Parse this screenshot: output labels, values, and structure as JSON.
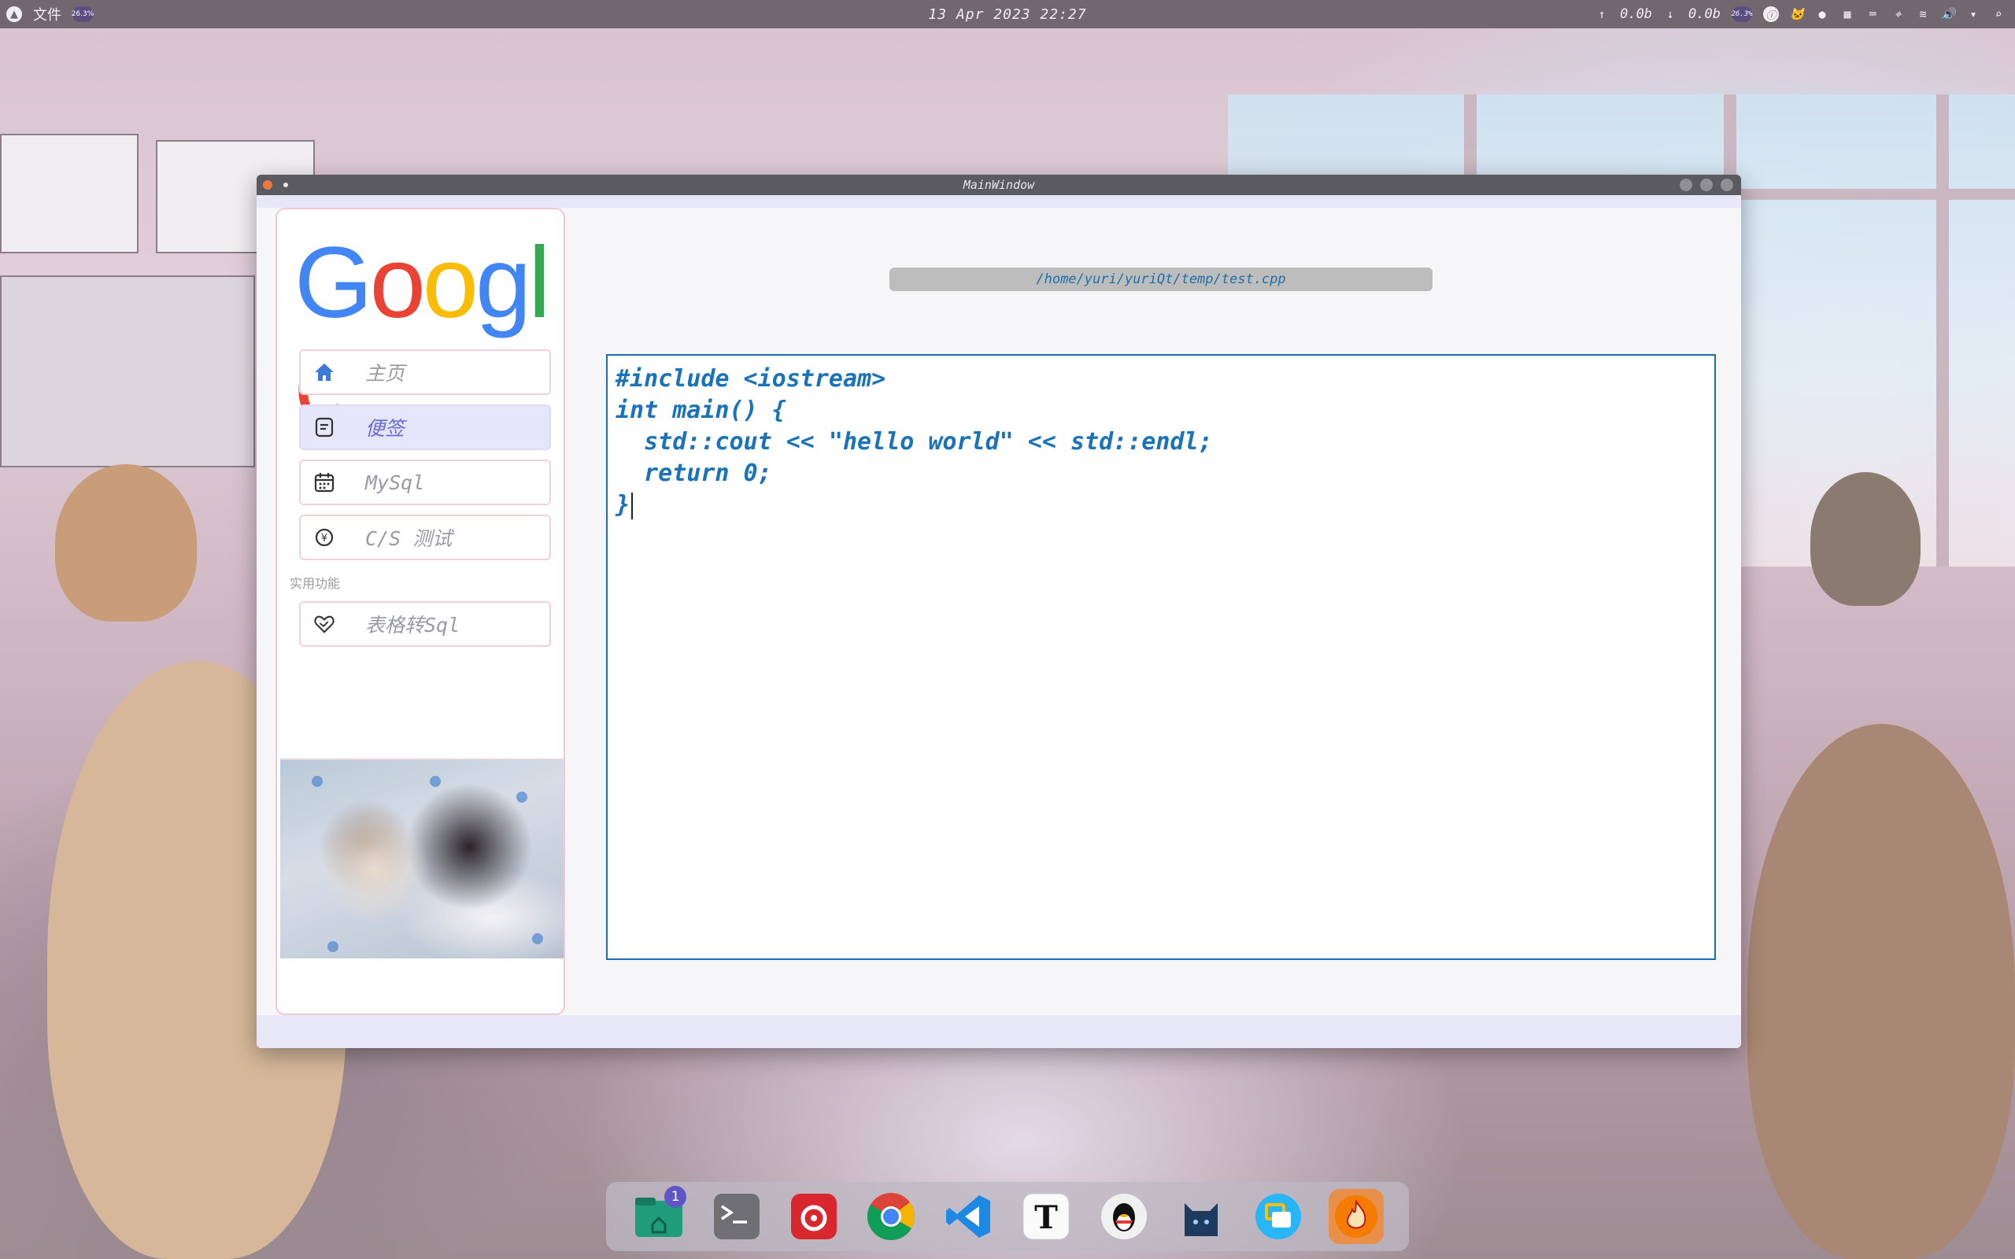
{
  "topbar": {
    "app_menu": "文件",
    "clock": "13 Apr 2023 22:27",
    "net_up": "0.0b",
    "net_down": "0.0b",
    "cpu_badge": "26.3%"
  },
  "window": {
    "title": "MainWindow",
    "path": "/home/yuri/yuriQt/temp/test.cpp"
  },
  "sidebar": {
    "items": [
      {
        "label": "主页",
        "icon": "home-icon"
      },
      {
        "label": "便签",
        "icon": "note-icon"
      },
      {
        "label": "MySql",
        "icon": "calendar-icon"
      },
      {
        "label": "C/S 测试",
        "icon": "currency-exchange-icon"
      }
    ],
    "section_label": "实用功能",
    "tools": [
      {
        "label": "表格转Sql",
        "icon": "heart-handshake-icon"
      }
    ]
  },
  "editor": {
    "lines": [
      "#include <iostream>",
      "int main() {",
      "  std::cout << \"hello world\" << std::endl;",
      "  return 0;",
      "}"
    ]
  },
  "dock": {
    "items": [
      {
        "name": "file-manager",
        "badge": "1"
      },
      {
        "name": "terminal"
      },
      {
        "name": "netease-music"
      },
      {
        "name": "chrome"
      },
      {
        "name": "vscode"
      },
      {
        "name": "typora"
      },
      {
        "name": "qq"
      },
      {
        "name": "clash-cat"
      },
      {
        "name": "screenshot-tool"
      },
      {
        "name": "flame-app"
      }
    ]
  },
  "colors": {
    "accent": "#1a72b9",
    "sidebar_border": "#f2c7d1",
    "active_item": "#e6e6fb",
    "topbar": "#72666f"
  }
}
